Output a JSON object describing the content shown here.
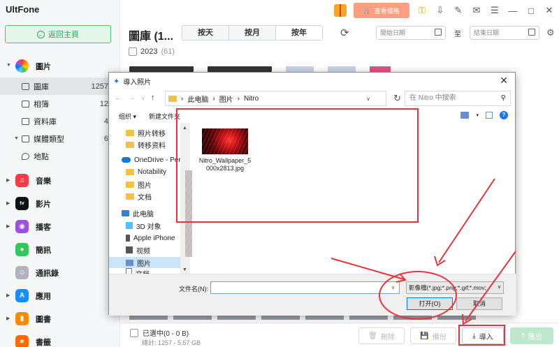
{
  "app": {
    "brand": "UltFone",
    "home_button": "返回主頁"
  },
  "sidebar": {
    "photos": {
      "label": "圖片",
      "icon": "photos-icon"
    },
    "sub_items": [
      {
        "label": "圖庫",
        "count": "1257",
        "icon": "gallery-icon"
      },
      {
        "label": "相簿",
        "count": "12",
        "icon": "album-icon"
      },
      {
        "label": "資料庫",
        "count": "4",
        "icon": "database-icon"
      },
      {
        "label": "媒體類型",
        "count": "6",
        "icon": "media-type-icon"
      },
      {
        "label": "地點",
        "count": "",
        "icon": "location-icon"
      }
    ],
    "categories": [
      {
        "label": "音樂",
        "color": "#fc3c44"
      },
      {
        "label": "影片",
        "color": "#111111"
      },
      {
        "label": "播客",
        "color": "#9b51e0"
      },
      {
        "label": "簡訊",
        "color": "#34c759"
      },
      {
        "label": "通訊錄",
        "color": "#b0b4ba"
      },
      {
        "label": "應用",
        "color": "#1a8cff"
      },
      {
        "label": "圖書",
        "color": "#ff8a00"
      },
      {
        "label": "書籤",
        "color": "#ff6a00"
      }
    ]
  },
  "header": {
    "price_button": "查看價格",
    "title": "圖庫 (1...",
    "segments": [
      "按天",
      "按月",
      "按年"
    ],
    "start_date_placeholder": "開始日期",
    "to_label": "至",
    "end_date_placeholder": "結束日期"
  },
  "content": {
    "year": "2023",
    "year_count": "(61)"
  },
  "bottom": {
    "selected": "已選中(0 - 0 B)",
    "total": "總計: 1257 - 5.57 GB",
    "delete": "刪除",
    "copy": "備份",
    "import": "導入",
    "export": "匯出"
  },
  "dialog": {
    "title": "導入照片",
    "path": [
      "此电脑",
      "图片",
      "Nitro"
    ],
    "search_placeholder": "在 Nitro 中搜索",
    "organize": "组织",
    "new_folder": "新建文件夹",
    "tree": [
      "照片转移",
      "转移资料",
      "OneDrive - Perso",
      "Notability",
      "图片",
      "文档",
      "此电脑",
      "3D 对象",
      "Apple iPhone",
      "视频",
      "图片",
      "文档"
    ],
    "file": {
      "name": "Nitro_Wallpaper_5000x2813.jpg"
    },
    "filename_label": "文件名(N):",
    "filetype": "影像檔(*.jpg;*.png;*.gif;*.mov;",
    "open_button": "打开(O)",
    "cancel_button": "取消"
  },
  "colors": {
    "accent": "#2ea55d",
    "annotation": "#e8333c",
    "price": "#ff9e80"
  }
}
